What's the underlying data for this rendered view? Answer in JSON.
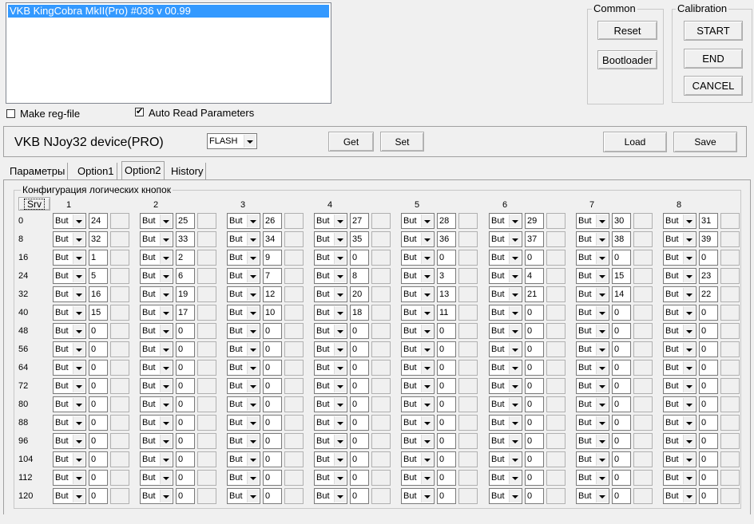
{
  "device_list": {
    "selected_item": "VKB KingCobra MkII(Pro)  #036  v 00.99"
  },
  "checkboxes": {
    "make_reg_file": "Make reg-file",
    "auto_read": "Auto Read Parameters"
  },
  "common": {
    "title": "Common",
    "reset": "Reset",
    "bootloader": "Bootloader"
  },
  "calibration": {
    "title": "Calibration",
    "start": "START",
    "end": "END",
    "cancel": "CANCEL"
  },
  "toolbar": {
    "device_name": "VKB NJoy32 device(PRO)",
    "memory_select": "FLASH",
    "get": "Get",
    "set": "Set",
    "load": "Load",
    "save": "Save"
  },
  "tabs": [
    "Параметры",
    "Option1",
    "Option2",
    "History"
  ],
  "active_tab": "Option2",
  "panel": {
    "title": "Конфигурация логических кнопок",
    "srv_button": "Srv",
    "columns": [
      "1",
      "2",
      "3",
      "4",
      "5",
      "6",
      "7",
      "8"
    ],
    "rows": [
      {
        "label": "0",
        "type": "But",
        "values": [
          "24",
          "25",
          "26",
          "27",
          "28",
          "29",
          "30",
          "31"
        ]
      },
      {
        "label": "8",
        "type": "But",
        "values": [
          "32",
          "33",
          "34",
          "35",
          "36",
          "37",
          "38",
          "39"
        ]
      },
      {
        "label": "16",
        "type": "But",
        "values": [
          "1",
          "2",
          "9",
          "0",
          "0",
          "0",
          "0",
          "0"
        ]
      },
      {
        "label": "24",
        "type": "But",
        "values": [
          "5",
          "6",
          "7",
          "8",
          "3",
          "4",
          "15",
          "23"
        ]
      },
      {
        "label": "32",
        "type": "But",
        "values": [
          "16",
          "19",
          "12",
          "20",
          "13",
          "21",
          "14",
          "22"
        ]
      },
      {
        "label": "40",
        "type": "But",
        "values": [
          "15",
          "17",
          "10",
          "18",
          "11",
          "0",
          "0",
          "0"
        ]
      },
      {
        "label": "48",
        "type": "But",
        "values": [
          "0",
          "0",
          "0",
          "0",
          "0",
          "0",
          "0",
          "0"
        ]
      },
      {
        "label": "56",
        "type": "But",
        "values": [
          "0",
          "0",
          "0",
          "0",
          "0",
          "0",
          "0",
          "0"
        ]
      },
      {
        "label": "64",
        "type": "But",
        "values": [
          "0",
          "0",
          "0",
          "0",
          "0",
          "0",
          "0",
          "0"
        ]
      },
      {
        "label": "72",
        "type": "But",
        "values": [
          "0",
          "0",
          "0",
          "0",
          "0",
          "0",
          "0",
          "0"
        ]
      },
      {
        "label": "80",
        "type": "But",
        "values": [
          "0",
          "0",
          "0",
          "0",
          "0",
          "0",
          "0",
          "0"
        ]
      },
      {
        "label": "88",
        "type": "But",
        "values": [
          "0",
          "0",
          "0",
          "0",
          "0",
          "0",
          "0",
          "0"
        ]
      },
      {
        "label": "96",
        "type": "But",
        "values": [
          "0",
          "0",
          "0",
          "0",
          "0",
          "0",
          "0",
          "0"
        ]
      },
      {
        "label": "104",
        "type": "But",
        "values": [
          "0",
          "0",
          "0",
          "0",
          "0",
          "0",
          "0",
          "0"
        ]
      },
      {
        "label": "112",
        "type": "But",
        "values": [
          "0",
          "0",
          "0",
          "0",
          "0",
          "0",
          "0",
          "0"
        ]
      },
      {
        "label": "120",
        "type": "But",
        "values": [
          "0",
          "0",
          "0",
          "0",
          "0",
          "0",
          "0",
          "0"
        ]
      }
    ]
  }
}
